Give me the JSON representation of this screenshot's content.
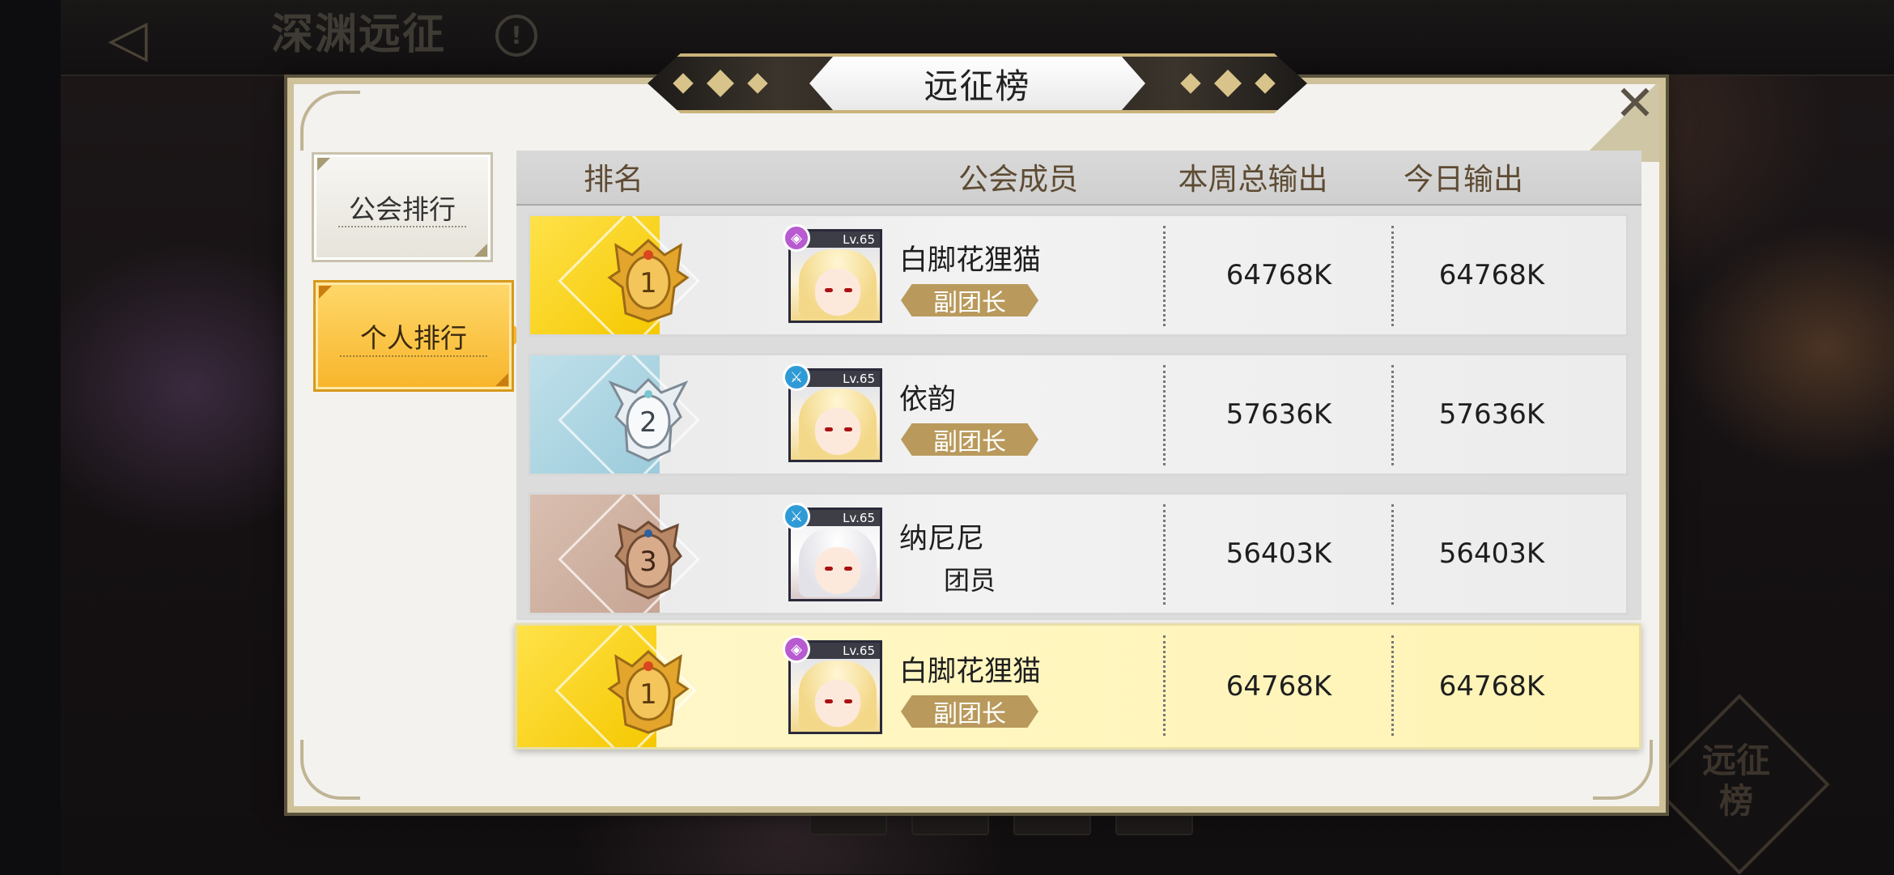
{
  "background": {
    "title": "深渊远征",
    "info_icon": "!",
    "corner_badge": "远征\n榜"
  },
  "dialog": {
    "title": "远征榜",
    "close_icon": "✕"
  },
  "tabs": [
    {
      "label": "公会排行",
      "selected": false
    },
    {
      "label": "个人排行",
      "selected": true
    }
  ],
  "table": {
    "headers": {
      "rank": "排名",
      "member": "公会成员",
      "week_total": "本周总输出",
      "today": "今日输出"
    },
    "rows": [
      {
        "rank": "1",
        "level": "Lv.65",
        "name": "白脚花狸猫",
        "role": "副团长",
        "week_total": "64768K",
        "today": "64768K"
      },
      {
        "rank": "2",
        "level": "Lv.65",
        "name": "依韵",
        "role": "副团长",
        "week_total": "57636K",
        "today": "57636K"
      },
      {
        "rank": "3",
        "level": "Lv.65",
        "name": "纳尼尼",
        "role": "团员",
        "week_total": "56403K",
        "today": "56403K"
      }
    ],
    "self_row": {
      "rank": "1",
      "level": "Lv.65",
      "name": "白脚花狸猫",
      "role": "副团长",
      "week_total": "64768K",
      "today": "64768K"
    }
  },
  "colors": {
    "gold": "#f5c800",
    "silver": "#9ccbdb",
    "bronze": "#c7a594",
    "role_badge": "#b99a5c",
    "selected_tab": "#f7b52b",
    "self_row": "#fff6c0"
  }
}
